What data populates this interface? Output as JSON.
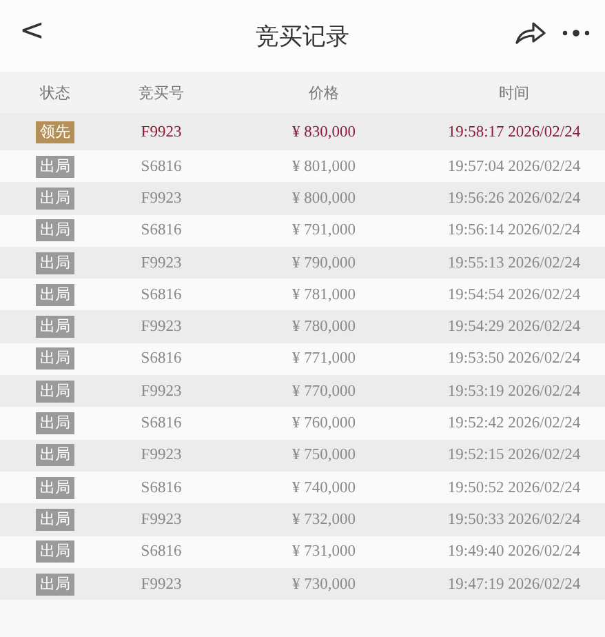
{
  "header": {
    "back": "<",
    "title": "竞买记录"
  },
  "table": {
    "columns": [
      "状态",
      "竞买号",
      "价格",
      "时间"
    ],
    "rows": [
      {
        "status": "领先",
        "kind": "leading",
        "number": "F9923",
        "price": "¥ 830,000",
        "time": "19:58:17 2026/02/24"
      },
      {
        "status": "出局",
        "kind": "out",
        "number": "S6816",
        "price": "¥ 801,000",
        "time": "19:57:04 2026/02/24"
      },
      {
        "status": "出局",
        "kind": "out",
        "number": "F9923",
        "price": "¥ 800,000",
        "time": "19:56:26 2026/02/24"
      },
      {
        "status": "出局",
        "kind": "out",
        "number": "S6816",
        "price": "¥ 791,000",
        "time": "19:56:14 2026/02/24"
      },
      {
        "status": "出局",
        "kind": "out",
        "number": "F9923",
        "price": "¥ 790,000",
        "time": "19:55:13 2026/02/24"
      },
      {
        "status": "出局",
        "kind": "out",
        "number": "S6816",
        "price": "¥ 781,000",
        "time": "19:54:54 2026/02/24"
      },
      {
        "status": "出局",
        "kind": "out",
        "number": "F9923",
        "price": "¥ 780,000",
        "time": "19:54:29 2026/02/24"
      },
      {
        "status": "出局",
        "kind": "out",
        "number": "S6816",
        "price": "¥ 771,000",
        "time": "19:53:50 2026/02/24"
      },
      {
        "status": "出局",
        "kind": "out",
        "number": "F9923",
        "price": "¥ 770,000",
        "time": "19:53:19 2026/02/24"
      },
      {
        "status": "出局",
        "kind": "out",
        "number": "S6816",
        "price": "¥ 760,000",
        "time": "19:52:42 2026/02/24"
      },
      {
        "status": "出局",
        "kind": "out",
        "number": "F9923",
        "price": "¥ 750,000",
        "time": "19:52:15 2026/02/24"
      },
      {
        "status": "出局",
        "kind": "out",
        "number": "S6816",
        "price": "¥ 740,000",
        "time": "19:50:52 2026/02/24"
      },
      {
        "status": "出局",
        "kind": "out",
        "number": "F9923",
        "price": "¥ 732,000",
        "time": "19:50:33 2026/02/24"
      },
      {
        "status": "出局",
        "kind": "out",
        "number": "S6816",
        "price": "¥ 731,000",
        "time": "19:49:40 2026/02/24"
      },
      {
        "status": "出局",
        "kind": "out",
        "number": "F9923",
        "price": "¥ 730,000",
        "time": "19:47:19 2026/02/24"
      }
    ]
  }
}
